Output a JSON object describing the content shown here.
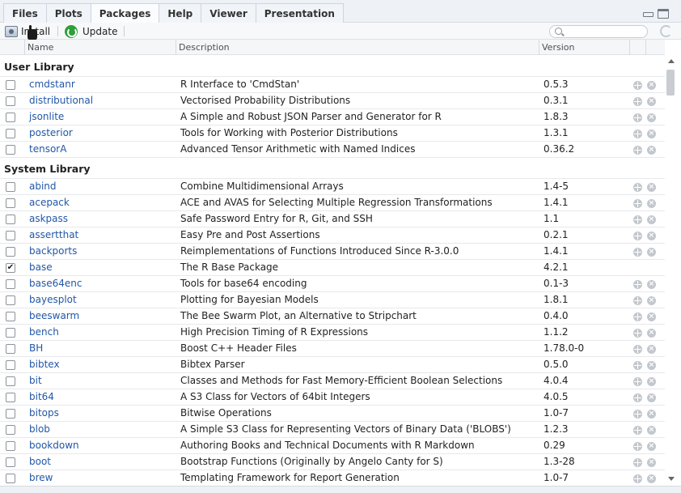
{
  "tabs": [
    {
      "label": "Files",
      "active": false
    },
    {
      "label": "Plots",
      "active": false
    },
    {
      "label": "Packages",
      "active": true
    },
    {
      "label": "Help",
      "active": false
    },
    {
      "label": "Viewer",
      "active": false
    },
    {
      "label": "Presentation",
      "active": false
    }
  ],
  "toolbar": {
    "install_label": "Install",
    "update_label": "Update",
    "search_placeholder": ""
  },
  "columns": {
    "name": "Name",
    "description": "Description",
    "version": "Version"
  },
  "user_library": {
    "title": "User Library",
    "packages": [
      {
        "name": "cmdstanr",
        "description": "R Interface to 'CmdStan'",
        "version": "0.5.3",
        "loaded": false
      },
      {
        "name": "distributional",
        "description": "Vectorised Probability Distributions",
        "version": "0.3.1",
        "loaded": false
      },
      {
        "name": "jsonlite",
        "description": "A Simple and Robust JSON Parser and Generator for R",
        "version": "1.8.3",
        "loaded": false
      },
      {
        "name": "posterior",
        "description": "Tools for Working with Posterior Distributions",
        "version": "1.3.1",
        "loaded": false
      },
      {
        "name": "tensorA",
        "description": "Advanced Tensor Arithmetic with Named Indices",
        "version": "0.36.2",
        "loaded": false
      }
    ]
  },
  "system_library": {
    "title": "System Library",
    "packages": [
      {
        "name": "abind",
        "description": "Combine Multidimensional Arrays",
        "version": "1.4-5",
        "loaded": false
      },
      {
        "name": "acepack",
        "description": "ACE and AVAS for Selecting Multiple Regression Transformations",
        "version": "1.4.1",
        "loaded": false
      },
      {
        "name": "askpass",
        "description": "Safe Password Entry for R, Git, and SSH",
        "version": "1.1",
        "loaded": false
      },
      {
        "name": "assertthat",
        "description": "Easy Pre and Post Assertions",
        "version": "0.2.1",
        "loaded": false
      },
      {
        "name": "backports",
        "description": "Reimplementations of Functions Introduced Since R-3.0.0",
        "version": "1.4.1",
        "loaded": false
      },
      {
        "name": "base",
        "description": "The R Base Package",
        "version": "4.2.1",
        "loaded": true
      },
      {
        "name": "base64enc",
        "description": "Tools for base64 encoding",
        "version": "0.1-3",
        "loaded": false
      },
      {
        "name": "bayesplot",
        "description": "Plotting for Bayesian Models",
        "version": "1.8.1",
        "loaded": false
      },
      {
        "name": "beeswarm",
        "description": "The Bee Swarm Plot, an Alternative to Stripchart",
        "version": "0.4.0",
        "loaded": false
      },
      {
        "name": "bench",
        "description": "High Precision Timing of R Expressions",
        "version": "1.1.2",
        "loaded": false
      },
      {
        "name": "BH",
        "description": "Boost C++ Header Files",
        "version": "1.78.0-0",
        "loaded": false
      },
      {
        "name": "bibtex",
        "description": "Bibtex Parser",
        "version": "0.5.0",
        "loaded": false
      },
      {
        "name": "bit",
        "description": "Classes and Methods for Fast Memory-Efficient Boolean Selections",
        "version": "4.0.4",
        "loaded": false
      },
      {
        "name": "bit64",
        "description": "A S3 Class for Vectors of 64bit Integers",
        "version": "4.0.5",
        "loaded": false
      },
      {
        "name": "bitops",
        "description": "Bitwise Operations",
        "version": "1.0-7",
        "loaded": false
      },
      {
        "name": "blob",
        "description": "A Simple S3 Class for Representing Vectors of Binary Data ('BLOBS')",
        "version": "1.2.3",
        "loaded": false
      },
      {
        "name": "bookdown",
        "description": "Authoring Books and Technical Documents with R Markdown",
        "version": "0.29",
        "loaded": false
      },
      {
        "name": "boot",
        "description": "Bootstrap Functions (Originally by Angelo Canty for S)",
        "version": "1.3-28",
        "loaded": false
      },
      {
        "name": "brew",
        "description": "Templating Framework for Report Generation",
        "version": "1.0-7",
        "loaded": false
      }
    ]
  }
}
